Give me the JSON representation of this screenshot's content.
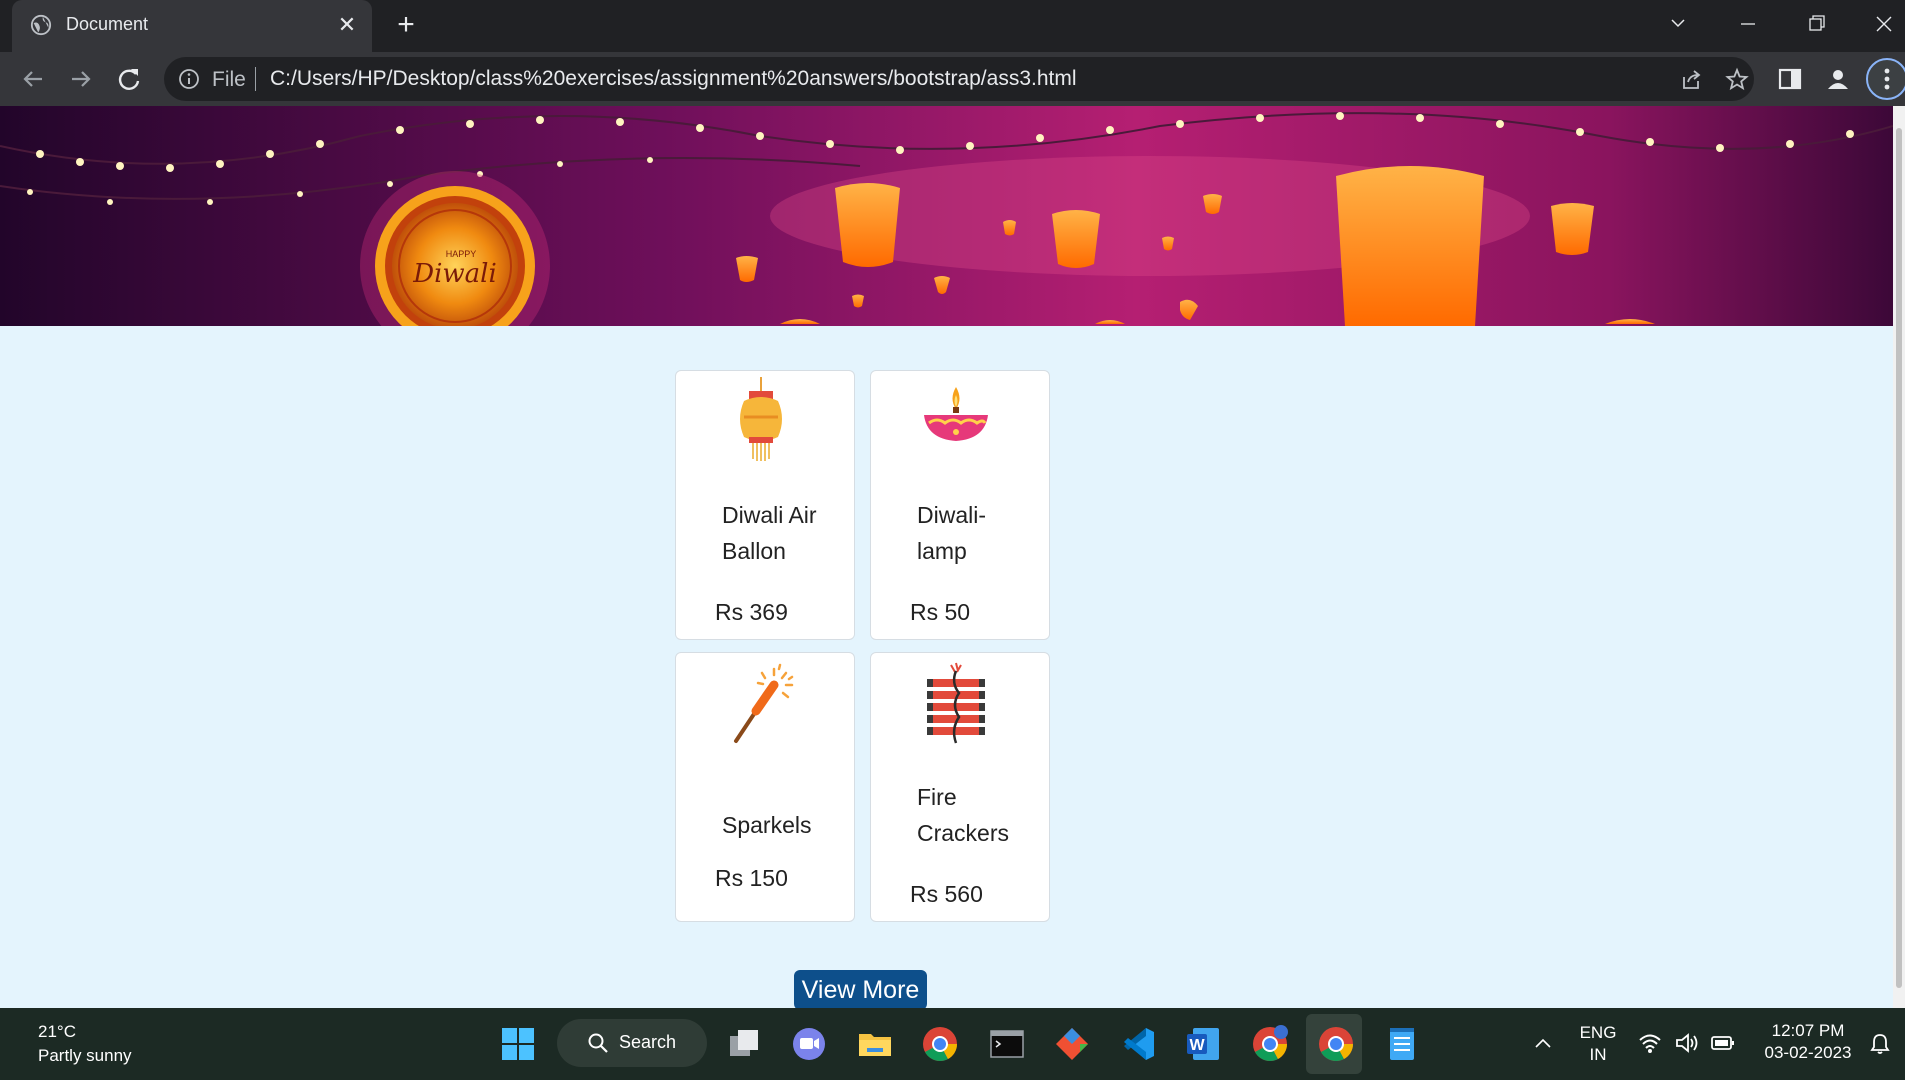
{
  "browser": {
    "tab_title": "Document",
    "new_tab_symbol": "+",
    "close_symbol": "✕",
    "scheme_label": "File",
    "url": "C:/Users/HP/Desktop/class%20exercises/assignment%20answers/bootstrap/ass3.html"
  },
  "products": [
    {
      "name": "Diwali Air Ballon",
      "price": "Rs 369",
      "icon": "lantern-icon"
    },
    {
      "name": "Diwali-lamp",
      "price": "Rs 50",
      "icon": "diya-icon"
    },
    {
      "name": "Sparkels",
      "price": "Rs 150",
      "icon": "sparkler-icon"
    },
    {
      "name": "Fire Crackers",
      "price": "Rs 560",
      "icon": "firecracker-icon"
    }
  ],
  "product_lines": [
    [
      "Diwali Air",
      "Ballon"
    ],
    [
      "Diwali-",
      "lamp"
    ],
    [
      "Sparkels"
    ],
    [
      "Fire",
      "Crackers"
    ]
  ],
  "banner": {
    "badge_small": "HAPPY",
    "badge_large": "Diwali"
  },
  "view_more_label": "View More",
  "taskbar": {
    "temperature": "21°C",
    "weather": "Partly sunny",
    "search_label": "Search",
    "lang_top": "ENG",
    "lang_bottom": "IN",
    "time": "12:07 PM",
    "date": "03-02-2023"
  },
  "colors": {
    "page_bg": "#e4f4fd",
    "button": "#0d4f8b",
    "banner_gradient": [
      "#2a0630",
      "#9c1a6b",
      "#d0307a"
    ]
  }
}
